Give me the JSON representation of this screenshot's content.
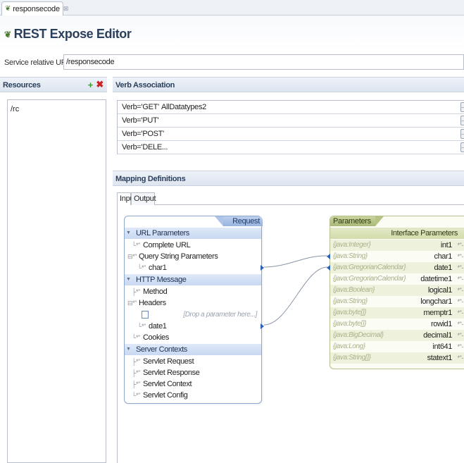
{
  "editor_tab": {
    "label": "responsecode",
    "close_glyph": "⊠"
  },
  "editor": {
    "title": "REST Expose Editor"
  },
  "service": {
    "label": "Service relative URI",
    "value": "/responsecode"
  },
  "resources": {
    "header": "Resources",
    "add_icon": "+",
    "delete_icon": "✖",
    "items": [
      "/rc"
    ]
  },
  "verbs": {
    "header": "Verb Association",
    "rows": [
      {
        "name": "Verb='GET'",
        "value": "AllDatatypes2"
      },
      {
        "name": "Verb='PUT'",
        "value": ""
      },
      {
        "name": "Verb='POST'",
        "value": ""
      },
      {
        "name": "Verb='DELE...",
        "value": ""
      }
    ],
    "button_label": "..."
  },
  "mapping": {
    "header": "Mapping Definitions",
    "tabs": [
      "Input",
      "Output"
    ],
    "active_tab": "Input",
    "request": {
      "title": "Request",
      "rows": [
        {
          "label": "URL Parameters",
          "type": "group"
        },
        {
          "label": "Complete URL",
          "glyph": "└*\""
        },
        {
          "label": "Query String Parameters",
          "glyph": "⊟*\""
        },
        {
          "label": "char1",
          "glyph": "└*\""
        },
        {
          "label": "HTTP Message",
          "type": "group"
        },
        {
          "label": "Method",
          "glyph": "├*\""
        },
        {
          "label": "Headers",
          "glyph": "⊟*\""
        },
        {
          "label": "[Drop a parameter here...]",
          "type": "drop"
        },
        {
          "label": "date1",
          "glyph": "└*\""
        },
        {
          "label": "Cookies",
          "glyph": "└*\""
        },
        {
          "label": "Server Contexts",
          "type": "group"
        },
        {
          "label": "Servlet Request",
          "glyph": "├*\""
        },
        {
          "label": "Servlet Response",
          "glyph": "├*\""
        },
        {
          "label": "Servlet Context",
          "glyph": "├*\""
        },
        {
          "label": "Servlet Config",
          "glyph": "└*\""
        }
      ]
    },
    "parameters": {
      "title": "Parameters",
      "subheader": "Interface Parameters",
      "rows": [
        {
          "type": "{java:Integer}",
          "name": "int1"
        },
        {
          "type": "{java:String}",
          "name": "char1"
        },
        {
          "type": "{java:GregorianCalendar}",
          "name": "date1"
        },
        {
          "type": "{java:GregorianCalendar}",
          "name": "datetime1"
        },
        {
          "type": "{java:Boolean}",
          "name": "logical1"
        },
        {
          "type": "{java:String}",
          "name": "longchar1"
        },
        {
          "type": "{java:byte[]}",
          "name": "memptr1"
        },
        {
          "type": "{java:byte[]}",
          "name": "rowid1"
        },
        {
          "type": "{java:BigDecimal}",
          "name": "decimal1"
        },
        {
          "type": "{java:Long}",
          "name": "int641"
        },
        {
          "type": "{java:String[]}",
          "name": "statext1"
        }
      ],
      "row_mark": "*\"-"
    }
  },
  "colors": {
    "accent": "#2a62b8",
    "group_bg": "#c8d9f1",
    "param_bg": "#eef2dc"
  }
}
